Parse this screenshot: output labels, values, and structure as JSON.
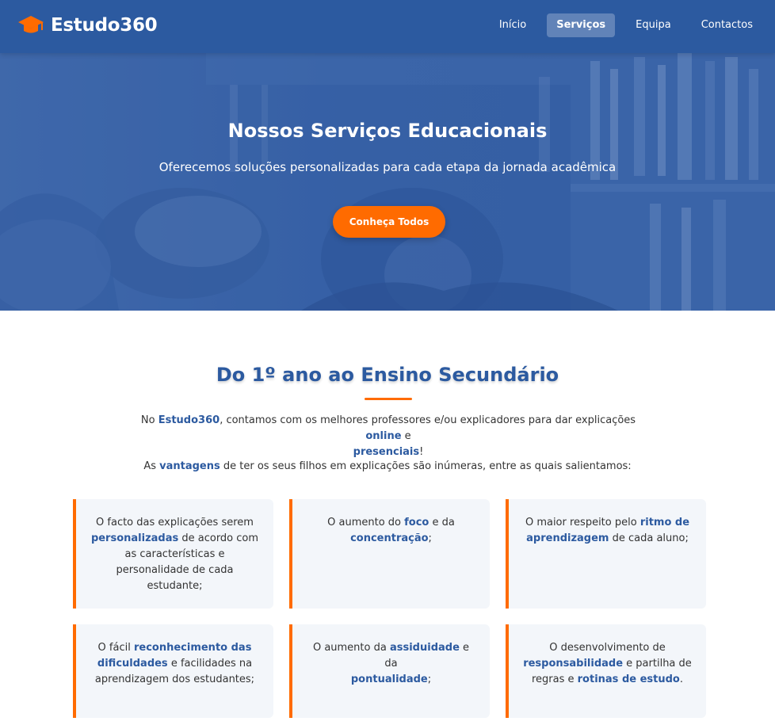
{
  "brand": {
    "name": "Estudo360",
    "icon": "graduation-cap-icon",
    "icon_color": "#ff6b00"
  },
  "nav": [
    {
      "label": "Início",
      "active": false
    },
    {
      "label": "Serviços",
      "active": true
    },
    {
      "label": "Equipa",
      "active": false
    },
    {
      "label": "Contactos",
      "active": false
    }
  ],
  "hero": {
    "title": "Nossos Serviços Educacionais",
    "subtitle": "Oferecemos soluções personalizadas para cada etapa da jornada acadêmica",
    "button": "Conheça Todos"
  },
  "section": {
    "title": "Do 1º ano ao Ensino Secundário",
    "intro": {
      "p1": "No ",
      "h1": "Estudo360",
      "p2": ", contamos com os melhores professores e/ou explicadores para dar explicações ",
      "h2": "online",
      "p3": " e ",
      "h3": "presenciais",
      "p4": "!"
    },
    "intro2": {
      "p1": "As ",
      "h1": "vantagens",
      "p2": " de ter os seus filhos em explicações são inúmeras, entre as quais salientamos:"
    }
  },
  "cards": [
    {
      "a": "O facto das explicações serem ",
      "b": "personalizadas",
      "c": " de acordo com as características e personalidade de cada estudante;",
      "d": "",
      "e": ""
    },
    {
      "a": "O aumento do ",
      "b": "foco",
      "c": " e da ",
      "d": "concentração",
      "e": ";"
    },
    {
      "a": "O maior respeito pelo ",
      "b": "ritmo de aprendizagem",
      "c": " de cada aluno;",
      "d": "",
      "e": ""
    },
    {
      "a": "O fácil ",
      "b": "reconhecimento das dificuldades",
      "c": " e facilidades na aprendizagem dos estudantes;",
      "d": "",
      "e": ""
    },
    {
      "a": "O aumento da ",
      "b": "assiduidade",
      "c": " e da ",
      "d": "pontualidade",
      "e": ";"
    },
    {
      "a": "O desenvolvimento de ",
      "b": "responsabilidade",
      "c": " e partilha de regras e ",
      "d": "rotinas de estudo",
      "e": "."
    }
  ],
  "colors": {
    "primary": "#2c5aa0",
    "accent": "#ff6b00",
    "card_bg": "#f3f6fa"
  }
}
